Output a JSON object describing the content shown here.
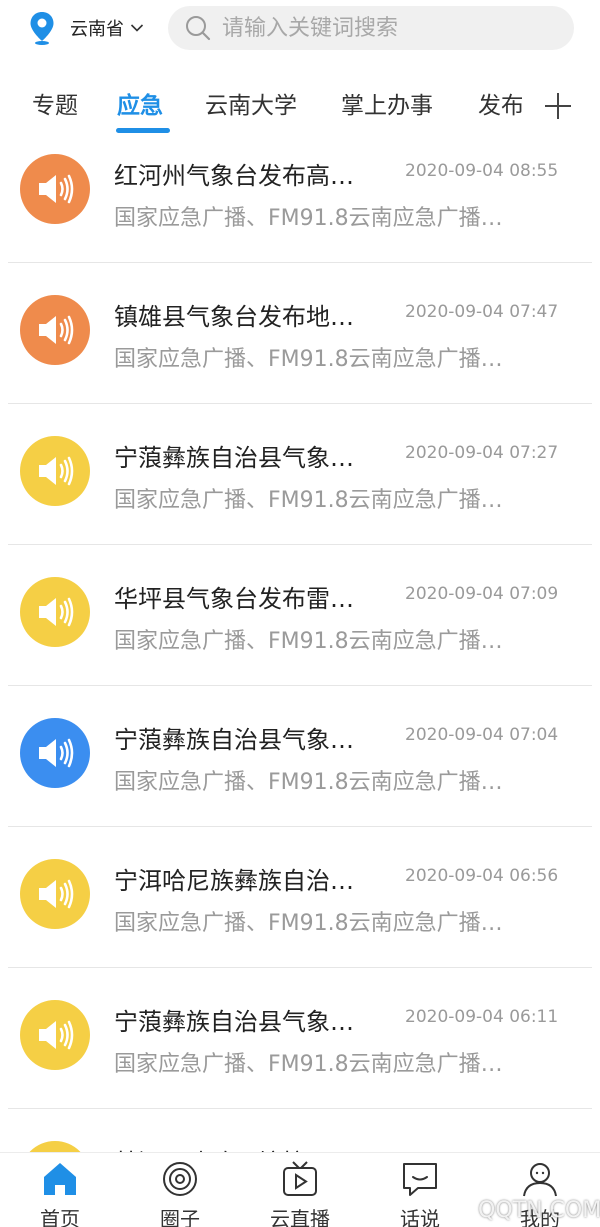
{
  "location": {
    "label": "云南省",
    "icon": "location-pin-icon"
  },
  "search": {
    "placeholder": "请输入关键词搜索"
  },
  "tabs": [
    {
      "label": "专题",
      "active": false
    },
    {
      "label": "应急",
      "active": true
    },
    {
      "label": "云南大学",
      "active": false
    },
    {
      "label": "掌上办事",
      "active": false
    },
    {
      "label": "发布",
      "active": false
    }
  ],
  "colors": {
    "accent": "#1f8fe6",
    "icon_orange": "#ef8b4c",
    "icon_yellow": "#f5cf45",
    "icon_blue": "#3b8ef0"
  },
  "items": [
    {
      "title": "红河州气象台发布高…",
      "time": "2020-09-04 08:55",
      "desc": "国家应急广播、FM91.8云南应急广播…",
      "icon_color": "orange"
    },
    {
      "title": "镇雄县气象台发布地…",
      "time": "2020-09-04 07:47",
      "desc": "国家应急广播、FM91.8云南应急广播…",
      "icon_color": "orange"
    },
    {
      "title": "宁蒗彝族自治县气象…",
      "time": "2020-09-04 07:27",
      "desc": "国家应急广播、FM91.8云南应急广播…",
      "icon_color": "yellow"
    },
    {
      "title": "华坪县气象台发布雷…",
      "time": "2020-09-04 07:09",
      "desc": "国家应急广播、FM91.8云南应急广播…",
      "icon_color": "yellow"
    },
    {
      "title": "宁蒗彝族自治县气象…",
      "time": "2020-09-04 07:04",
      "desc": "国家应急广播、FM91.8云南应急广播…",
      "icon_color": "blue"
    },
    {
      "title": "宁洱哈尼族彝族自治…",
      "time": "2020-09-04 06:56",
      "desc": "国家应急广播、FM91.8云南应急广播…",
      "icon_color": "yellow"
    },
    {
      "title": "宁蒗彝族自治县气象…",
      "time": "2020-09-04 06:11",
      "desc": "国家应急广播、FM91.8云南应急广播…",
      "icon_color": "yellow"
    },
    {
      "title": "楚源县迪政县塘拉…",
      "time": "",
      "desc": "",
      "icon_color": "yellow"
    }
  ],
  "bottom_nav": [
    {
      "label": "首页",
      "icon": "home-icon",
      "active": true
    },
    {
      "label": "圈子",
      "icon": "circle-icon",
      "active": false
    },
    {
      "label": "云直播",
      "icon": "tv-play-icon",
      "active": false
    },
    {
      "label": "话说",
      "icon": "chat-icon",
      "active": false
    },
    {
      "label": "我的",
      "icon": "user-icon",
      "active": false
    }
  ],
  "watermark": "QQTN.COM"
}
